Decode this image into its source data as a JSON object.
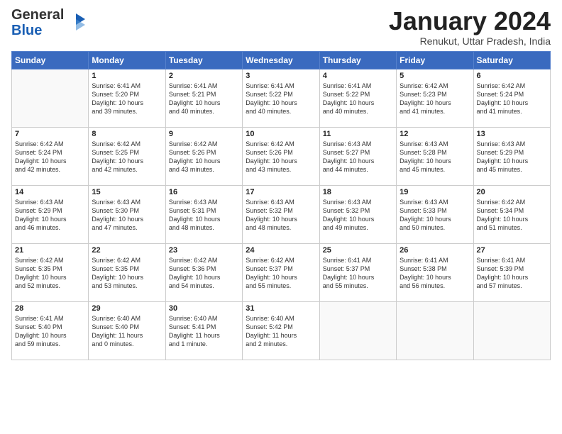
{
  "logo": {
    "general": "General",
    "blue": "Blue"
  },
  "header": {
    "month": "January 2024",
    "location": "Renukut, Uttar Pradesh, India"
  },
  "days_of_week": [
    "Sunday",
    "Monday",
    "Tuesday",
    "Wednesday",
    "Thursday",
    "Friday",
    "Saturday"
  ],
  "weeks": [
    [
      {
        "day": "",
        "info": ""
      },
      {
        "day": "1",
        "info": "Sunrise: 6:41 AM\nSunset: 5:20 PM\nDaylight: 10 hours\nand 39 minutes."
      },
      {
        "day": "2",
        "info": "Sunrise: 6:41 AM\nSunset: 5:21 PM\nDaylight: 10 hours\nand 40 minutes."
      },
      {
        "day": "3",
        "info": "Sunrise: 6:41 AM\nSunset: 5:22 PM\nDaylight: 10 hours\nand 40 minutes."
      },
      {
        "day": "4",
        "info": "Sunrise: 6:41 AM\nSunset: 5:22 PM\nDaylight: 10 hours\nand 40 minutes."
      },
      {
        "day": "5",
        "info": "Sunrise: 6:42 AM\nSunset: 5:23 PM\nDaylight: 10 hours\nand 41 minutes."
      },
      {
        "day": "6",
        "info": "Sunrise: 6:42 AM\nSunset: 5:24 PM\nDaylight: 10 hours\nand 41 minutes."
      }
    ],
    [
      {
        "day": "7",
        "info": "Sunrise: 6:42 AM\nSunset: 5:24 PM\nDaylight: 10 hours\nand 42 minutes."
      },
      {
        "day": "8",
        "info": "Sunrise: 6:42 AM\nSunset: 5:25 PM\nDaylight: 10 hours\nand 42 minutes."
      },
      {
        "day": "9",
        "info": "Sunrise: 6:42 AM\nSunset: 5:26 PM\nDaylight: 10 hours\nand 43 minutes."
      },
      {
        "day": "10",
        "info": "Sunrise: 6:42 AM\nSunset: 5:26 PM\nDaylight: 10 hours\nand 43 minutes."
      },
      {
        "day": "11",
        "info": "Sunrise: 6:43 AM\nSunset: 5:27 PM\nDaylight: 10 hours\nand 44 minutes."
      },
      {
        "day": "12",
        "info": "Sunrise: 6:43 AM\nSunset: 5:28 PM\nDaylight: 10 hours\nand 45 minutes."
      },
      {
        "day": "13",
        "info": "Sunrise: 6:43 AM\nSunset: 5:29 PM\nDaylight: 10 hours\nand 45 minutes."
      }
    ],
    [
      {
        "day": "14",
        "info": "Sunrise: 6:43 AM\nSunset: 5:29 PM\nDaylight: 10 hours\nand 46 minutes."
      },
      {
        "day": "15",
        "info": "Sunrise: 6:43 AM\nSunset: 5:30 PM\nDaylight: 10 hours\nand 47 minutes."
      },
      {
        "day": "16",
        "info": "Sunrise: 6:43 AM\nSunset: 5:31 PM\nDaylight: 10 hours\nand 48 minutes."
      },
      {
        "day": "17",
        "info": "Sunrise: 6:43 AM\nSunset: 5:32 PM\nDaylight: 10 hours\nand 48 minutes."
      },
      {
        "day": "18",
        "info": "Sunrise: 6:43 AM\nSunset: 5:32 PM\nDaylight: 10 hours\nand 49 minutes."
      },
      {
        "day": "19",
        "info": "Sunrise: 6:43 AM\nSunset: 5:33 PM\nDaylight: 10 hours\nand 50 minutes."
      },
      {
        "day": "20",
        "info": "Sunrise: 6:42 AM\nSunset: 5:34 PM\nDaylight: 10 hours\nand 51 minutes."
      }
    ],
    [
      {
        "day": "21",
        "info": "Sunrise: 6:42 AM\nSunset: 5:35 PM\nDaylight: 10 hours\nand 52 minutes."
      },
      {
        "day": "22",
        "info": "Sunrise: 6:42 AM\nSunset: 5:35 PM\nDaylight: 10 hours\nand 53 minutes."
      },
      {
        "day": "23",
        "info": "Sunrise: 6:42 AM\nSunset: 5:36 PM\nDaylight: 10 hours\nand 54 minutes."
      },
      {
        "day": "24",
        "info": "Sunrise: 6:42 AM\nSunset: 5:37 PM\nDaylight: 10 hours\nand 55 minutes."
      },
      {
        "day": "25",
        "info": "Sunrise: 6:41 AM\nSunset: 5:37 PM\nDaylight: 10 hours\nand 55 minutes."
      },
      {
        "day": "26",
        "info": "Sunrise: 6:41 AM\nSunset: 5:38 PM\nDaylight: 10 hours\nand 56 minutes."
      },
      {
        "day": "27",
        "info": "Sunrise: 6:41 AM\nSunset: 5:39 PM\nDaylight: 10 hours\nand 57 minutes."
      }
    ],
    [
      {
        "day": "28",
        "info": "Sunrise: 6:41 AM\nSunset: 5:40 PM\nDaylight: 10 hours\nand 59 minutes."
      },
      {
        "day": "29",
        "info": "Sunrise: 6:40 AM\nSunset: 5:40 PM\nDaylight: 11 hours\nand 0 minutes."
      },
      {
        "day": "30",
        "info": "Sunrise: 6:40 AM\nSunset: 5:41 PM\nDaylight: 11 hours\nand 1 minute."
      },
      {
        "day": "31",
        "info": "Sunrise: 6:40 AM\nSunset: 5:42 PM\nDaylight: 11 hours\nand 2 minutes."
      },
      {
        "day": "",
        "info": ""
      },
      {
        "day": "",
        "info": ""
      },
      {
        "day": "",
        "info": ""
      }
    ]
  ]
}
